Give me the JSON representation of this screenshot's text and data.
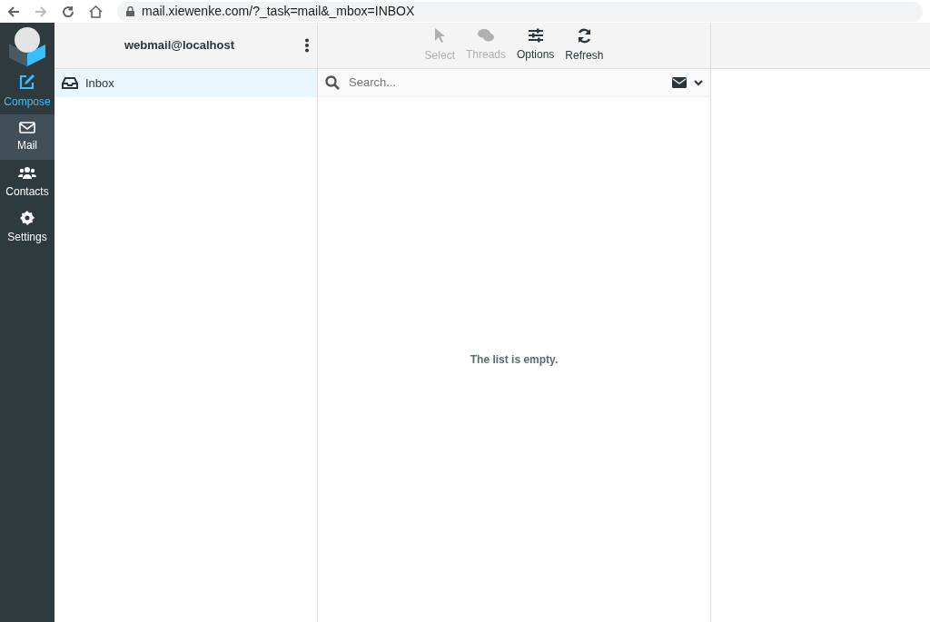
{
  "browser": {
    "url": "mail.xiewenke.com/?_task=mail&_mbox=INBOX"
  },
  "nav": [
    {
      "label": "Compose",
      "kind": "action",
      "selected": false
    },
    {
      "label": "Mail",
      "kind": "section",
      "selected": true
    },
    {
      "label": "Contacts",
      "kind": "section",
      "selected": false
    },
    {
      "label": "Settings",
      "kind": "section",
      "selected": false
    }
  ],
  "account": {
    "title": "webmail@localhost"
  },
  "folders": [
    {
      "label": "Inbox",
      "selected": true
    }
  ],
  "toolbar": [
    {
      "label": "Select",
      "disabled": true
    },
    {
      "label": "Threads",
      "disabled": true
    },
    {
      "label": "Options",
      "disabled": false
    },
    {
      "label": "Refresh",
      "disabled": false
    }
  ],
  "search": {
    "placeholder": "Search..."
  },
  "message_list": {
    "empty_text": "The list is empty."
  }
}
